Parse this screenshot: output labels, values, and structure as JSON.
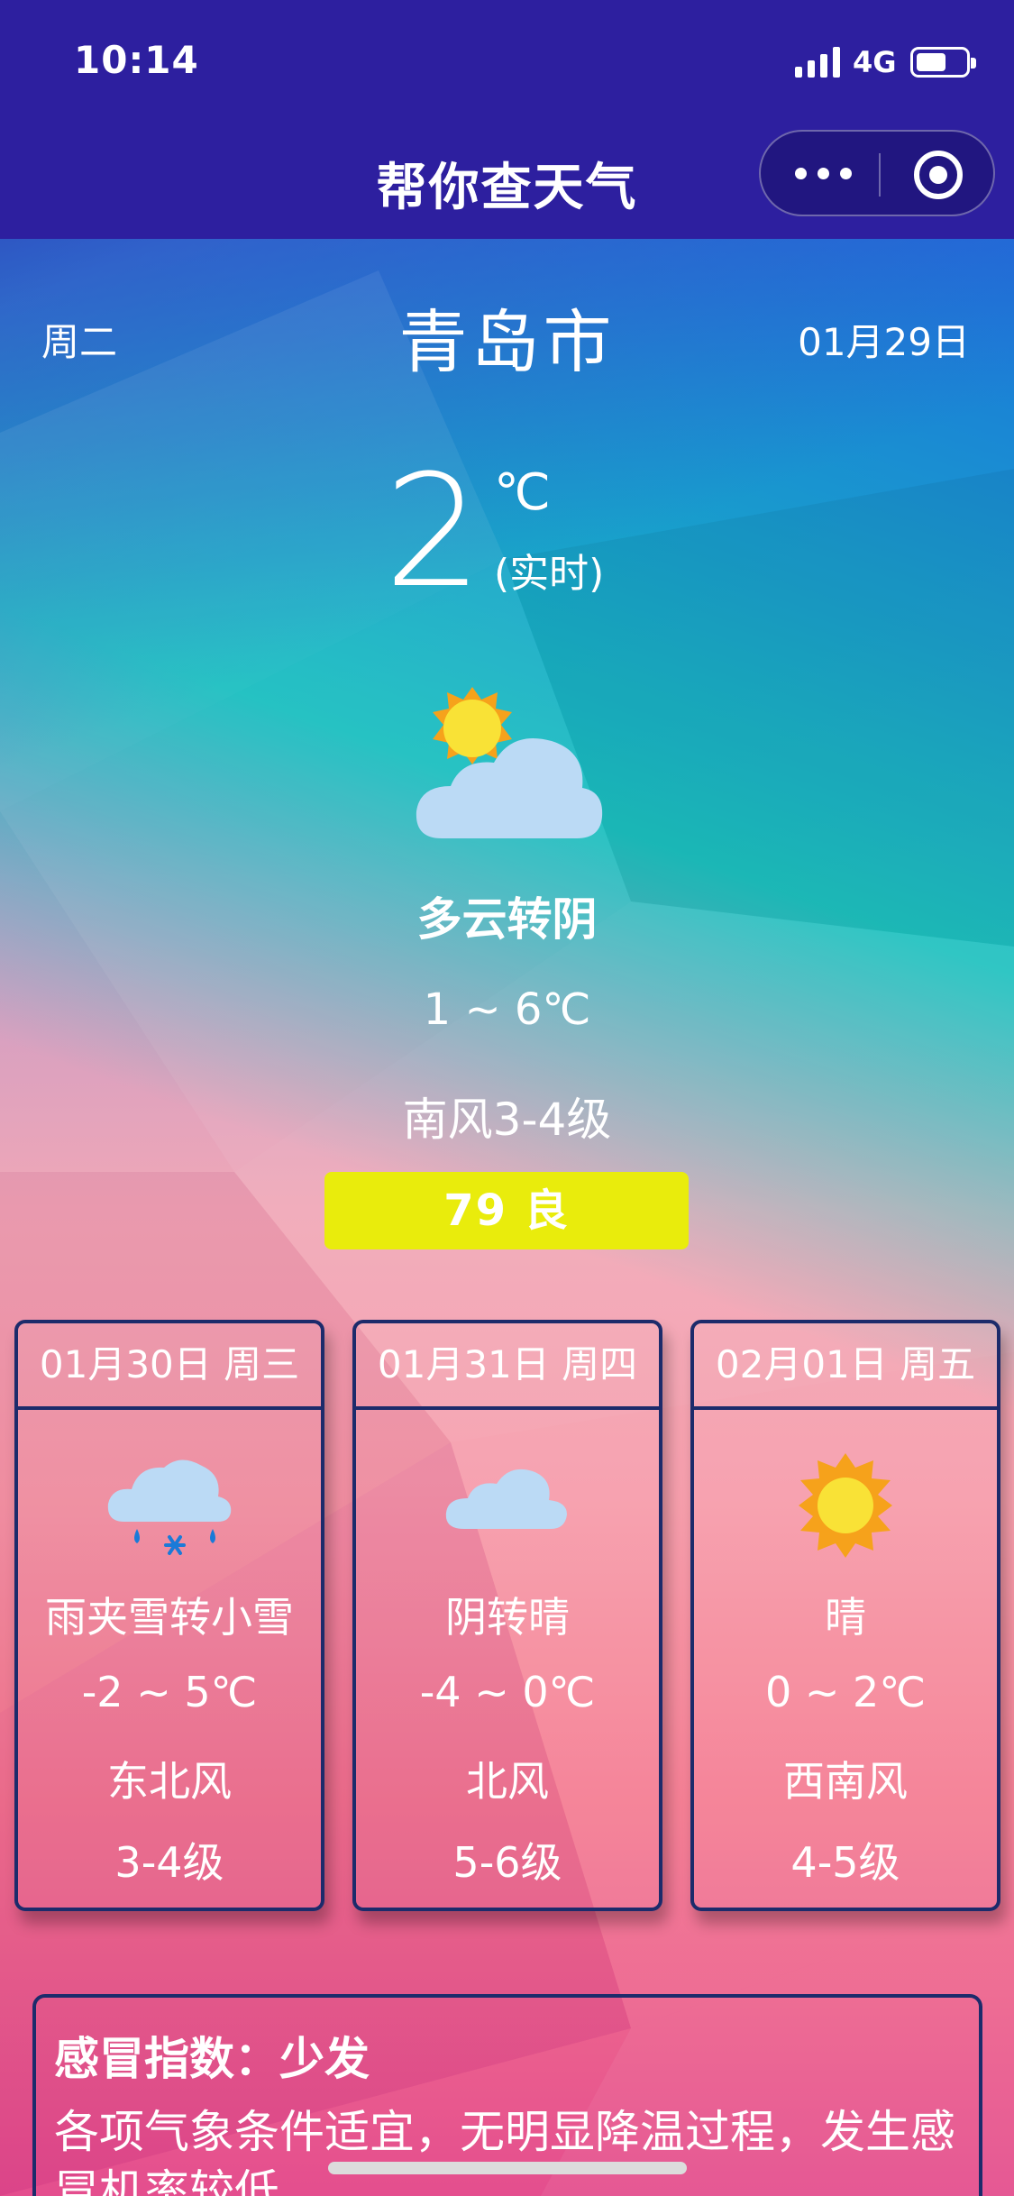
{
  "status_bar": {
    "time": "10:14",
    "network": "4G"
  },
  "nav": {
    "title": "帮你查天气",
    "more_icon": "more-dots-icon",
    "close_icon": "target-circle-icon"
  },
  "header": {
    "weekday": "周二",
    "city": "青岛市",
    "date": "01月29日"
  },
  "current": {
    "temperature": "2",
    "unit": "℃",
    "realtime_label": "(实时)",
    "icon": "partly-cloudy-icon",
    "condition": "多云转阴",
    "range": "1 ~ 6℃",
    "wind": "南风3-4级",
    "aqi": "79 良",
    "aqi_color": "#e9ec0c"
  },
  "forecast": [
    {
      "date": "01月30日 周三",
      "icon": "rain-snow-icon",
      "condition": "雨夹雪转小雪",
      "range": "-2 ~ 5℃",
      "wind_dir": "东北风",
      "wind_level": "3-4级"
    },
    {
      "date": "01月31日 周四",
      "icon": "cloud-icon",
      "condition": "阴转晴",
      "range": "-4 ~ 0℃",
      "wind_dir": "北风",
      "wind_level": "5-6级"
    },
    {
      "date": "02月01日 周五",
      "icon": "sun-icon",
      "condition": "晴",
      "range": "0 ~ 2℃",
      "wind_dir": "西南风",
      "wind_level": "4-5级"
    }
  ],
  "cold_index": {
    "title": "感冒指数：少发",
    "body": "各项气象条件适宜，无明显降温过程，发生感冒机率较低。"
  }
}
